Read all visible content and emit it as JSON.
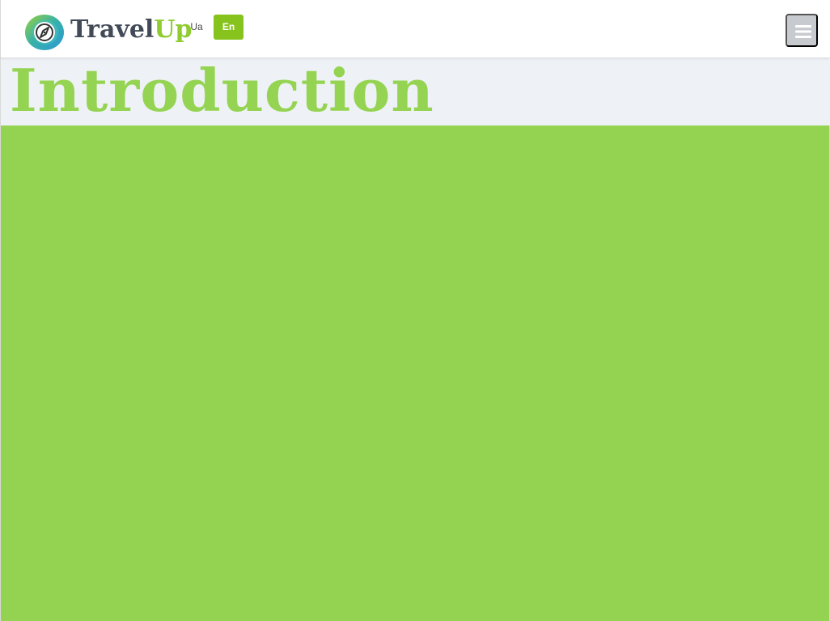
{
  "brand": {
    "name_part_1": "Travel",
    "name_part_2": "Up",
    "logo_icon": "compass-icon"
  },
  "language_switcher": {
    "options": [
      {
        "label": "Ua",
        "selected": false
      },
      {
        "label": "En",
        "selected": true
      }
    ]
  },
  "navigation": {
    "menu_icon": "hamburger-menu-icon"
  },
  "page": {
    "title": "Introduction"
  },
  "colors": {
    "accent_green": "#94d351",
    "selected_language": "#86c41d",
    "title_band": "#eef2f6",
    "menu_button": "#c7cbd0",
    "logo_text_dark": "#424a57"
  }
}
